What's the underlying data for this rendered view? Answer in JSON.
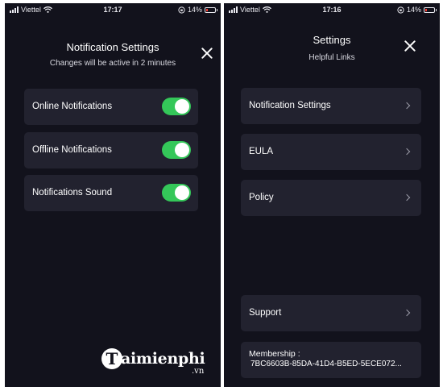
{
  "left_screen": {
    "status_bar": {
      "carrier": "Viettel",
      "time": "17:17",
      "battery_percent": "14%",
      "icons": [
        "signal-icon",
        "wifi-icon",
        "orientation-lock-icon",
        "battery-icon"
      ]
    },
    "title": "Notification Settings",
    "subtitle": "Changes will be active in 2 minutes",
    "close_icon": "close-icon",
    "toggles": [
      {
        "label": "Online Notifications",
        "on": true
      },
      {
        "label": "Offline Notifications",
        "on": true
      },
      {
        "label": "Notifications Sound",
        "on": true
      }
    ]
  },
  "right_screen": {
    "status_bar": {
      "carrier": "Viettel",
      "time": "17:16",
      "battery_percent": "14%",
      "icons": [
        "signal-icon",
        "wifi-icon",
        "orientation-lock-icon",
        "battery-icon"
      ]
    },
    "title": "Settings",
    "subtitle": "Helpful Links",
    "close_icon": "close-icon",
    "links": [
      {
        "label": "Notification Settings"
      },
      {
        "label": "EULA"
      },
      {
        "label": "Policy"
      },
      {
        "label": "Support"
      }
    ],
    "membership": {
      "label": "Membership :",
      "value": "7BC6603B-85DA-41D4-B5ED-5ECE072..."
    }
  },
  "watermark": {
    "text": "Taimienphi",
    "tld": ".vn"
  },
  "colors": {
    "background": "#12121c",
    "card": "#22222f",
    "toggle_on": "#34c759",
    "battery_low": "#ff3b30"
  }
}
